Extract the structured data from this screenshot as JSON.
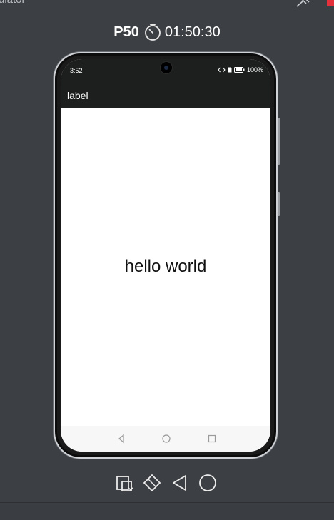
{
  "window": {
    "title": "ulator",
    "colors": {
      "background": "#3c3f43",
      "close": "#e5323a"
    }
  },
  "header": {
    "device_name": "P50",
    "timer_icon": "timer-icon",
    "timer_value": "01:50:30"
  },
  "phone": {
    "status_bar": {
      "time": "3:52",
      "battery": "100%",
      "icons": [
        "code-icon",
        "sim-icon",
        "battery-icon"
      ]
    },
    "app_bar": {
      "title": "label",
      "color": "#1d1f1f"
    },
    "content": {
      "text": "hello world"
    },
    "nav_bar": {
      "icons": [
        "back-icon",
        "home-icon",
        "recents-icon"
      ]
    }
  },
  "toolbar": {
    "icons": [
      "screenshot-icon",
      "rotate-icon",
      "back-icon",
      "home-icon"
    ]
  }
}
